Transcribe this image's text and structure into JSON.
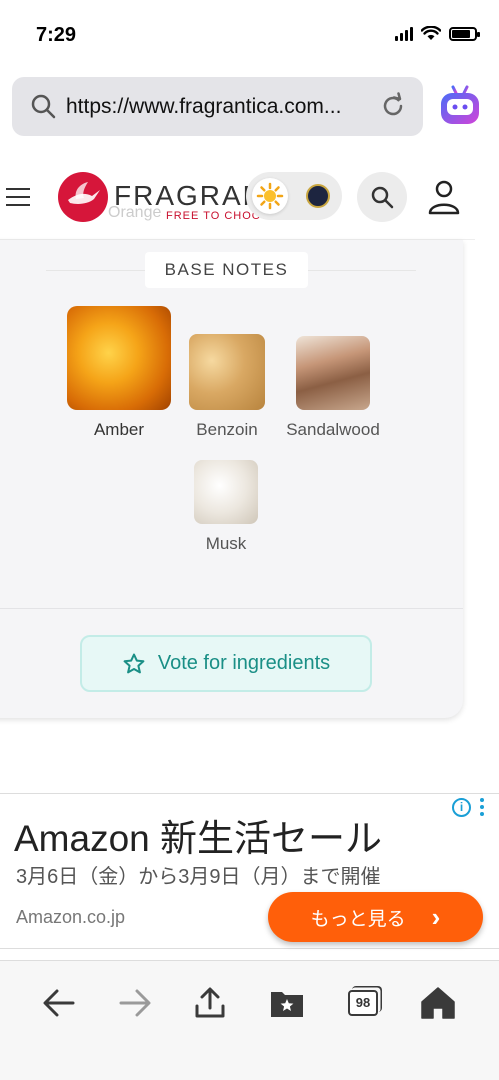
{
  "status": {
    "time": "7:29",
    "battery_level": 0.8
  },
  "browser": {
    "url": "https://www.fragrantica.com..."
  },
  "site": {
    "logo_text": "FRAGRAN",
    "logo_tagline": "FREE TO CHOOSE",
    "ghost_text": "Orange"
  },
  "base_notes": {
    "title": "BASE NOTES",
    "items": [
      {
        "label": "Amber"
      },
      {
        "label": "Benzoin"
      },
      {
        "label": "Sandalwood"
      },
      {
        "label": "Musk"
      }
    ]
  },
  "vote": {
    "label": "Vote for ingredients"
  },
  "ad": {
    "title": "Amazon 新生活セール",
    "subtitle": "3月6日（金）から3月9日（月）まで開催",
    "domain": "Amazon.co.jp",
    "cta": "もっと見る",
    "cta_arrow": "›",
    "info": "i"
  },
  "toolbar": {
    "tab_count": "98"
  },
  "colors": {
    "brand": "#d6163a",
    "accent": "#1a8f86",
    "cta": "#ff5f0a"
  },
  "icons": [
    "search-icon",
    "reload-icon",
    "bot-icon",
    "menu-icon",
    "sun-icon",
    "moon-icon",
    "user-icon",
    "star-icon",
    "back-icon",
    "forward-icon",
    "share-icon",
    "bookmarks-icon",
    "tabs-icon",
    "home-icon"
  ]
}
